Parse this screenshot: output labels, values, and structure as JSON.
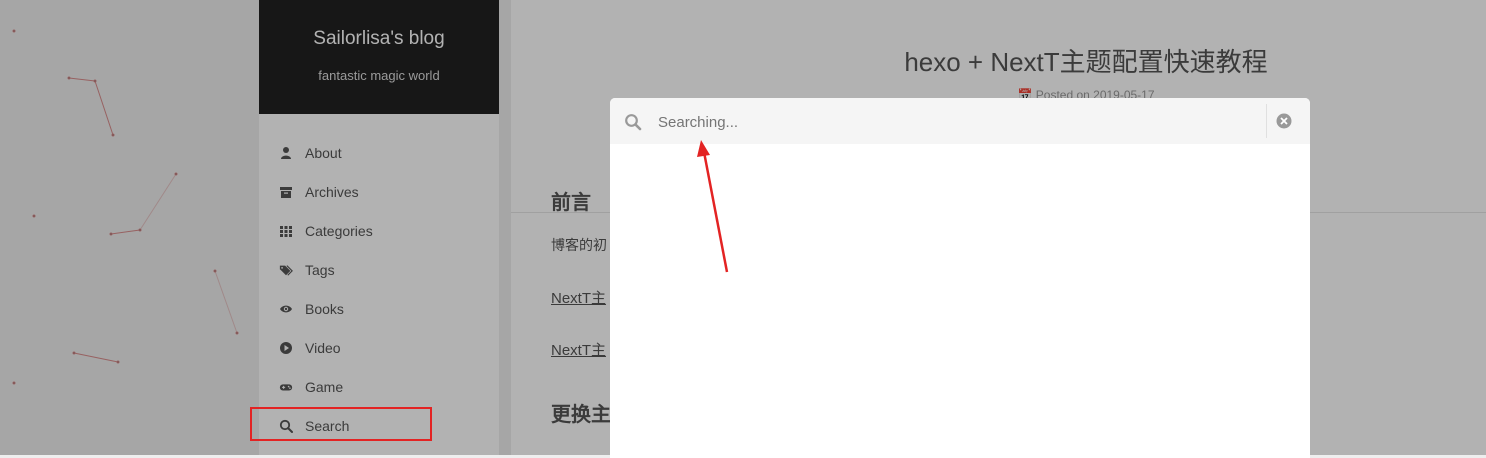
{
  "site": {
    "title": "Sailorlisa's blog",
    "subtitle": "fantastic magic world"
  },
  "menu": {
    "items": [
      {
        "label": "About",
        "icon": "user-icon"
      },
      {
        "label": "Archives",
        "icon": "archive-icon"
      },
      {
        "label": "Categories",
        "icon": "grid-icon"
      },
      {
        "label": "Tags",
        "icon": "tags-icon"
      },
      {
        "label": "Books",
        "icon": "eye-icon"
      },
      {
        "label": "Video",
        "icon": "play-circle-icon"
      },
      {
        "label": "Game",
        "icon": "gamepad-icon"
      },
      {
        "label": "Search",
        "icon": "search-icon"
      }
    ]
  },
  "post": {
    "title": "hexo + NextT主题配置快速教程",
    "meta": "Posted on 2019-05-17",
    "heading_preface": "前言",
    "intro_text": "博客的初",
    "link_1": "NextT主",
    "link_2": "NextT主",
    "heading_theme": "更换主"
  },
  "search": {
    "placeholder": "Searching...",
    "value": ""
  },
  "colors": {
    "sidebar_header": "#222222",
    "annotation": "#e32323",
    "overlay": "rgba(0,0,0,0.3)"
  }
}
